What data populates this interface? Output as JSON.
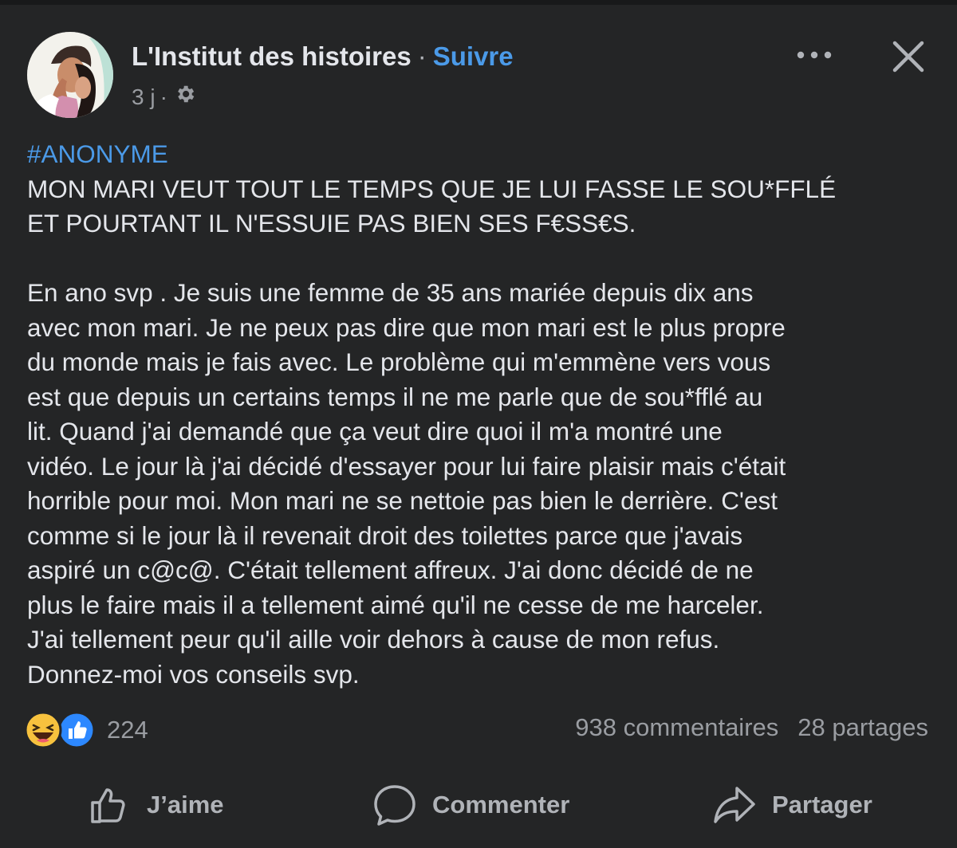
{
  "post": {
    "page_name": "L'Institut des histoires",
    "separator": "·",
    "follow_label": "Suivre",
    "time": "3 j",
    "time_separator": "·",
    "audience_icon": "gear-icon",
    "hashtag": "#ANONYME",
    "body_lines": [
      "MON MARI VEUT TOUT LE TEMPS QUE JE LUI FASSE LE SOU*FFLÉ",
      "ET POURTANT IL N'ESSUIE PAS BIEN SES F€SS€S.",
      "",
      "En ano svp . Je suis une femme de 35 ans mariée depuis dix ans",
      "avec mon mari. Je ne peux pas dire que mon mari est le plus propre",
      "du monde mais je fais avec. Le problème qui m'emmène vers vous",
      "est que depuis un certains temps il ne me parle que de sou*fflé au",
      "lit. Quand j'ai demandé que ça veut dire quoi il m'a montré une",
      "vidéo. Le jour là j'ai décidé d'essayer pour lui faire plaisir mais c'était",
      "horrible pour moi. Mon mari ne se nettoie pas bien le derrière. C'est",
      "comme si le jour là il revenait droit des toilettes parce que j'avais",
      "aspiré un c@c@. C'était tellement affreux. J'ai donc décidé de ne",
      "plus le faire mais il a tellement aimé qu'il ne cesse de me harceler.",
      "J'ai tellement peur qu'il aille voir dehors à cause de mon refus.",
      "Donnez-moi vos conseils svp."
    ]
  },
  "stats": {
    "reaction_icons": [
      "haha-icon",
      "like-icon"
    ],
    "reaction_count": "224",
    "comments": "938 commentaires",
    "shares": "28 partages"
  },
  "actions": {
    "like_label": "J’aime",
    "comment_label": "Commenter",
    "share_label": "Partager"
  },
  "colors": {
    "background": "#242526",
    "text": "#e4e6eb",
    "secondary_text": "#9a9da2",
    "accent": "#4b9ae8"
  }
}
